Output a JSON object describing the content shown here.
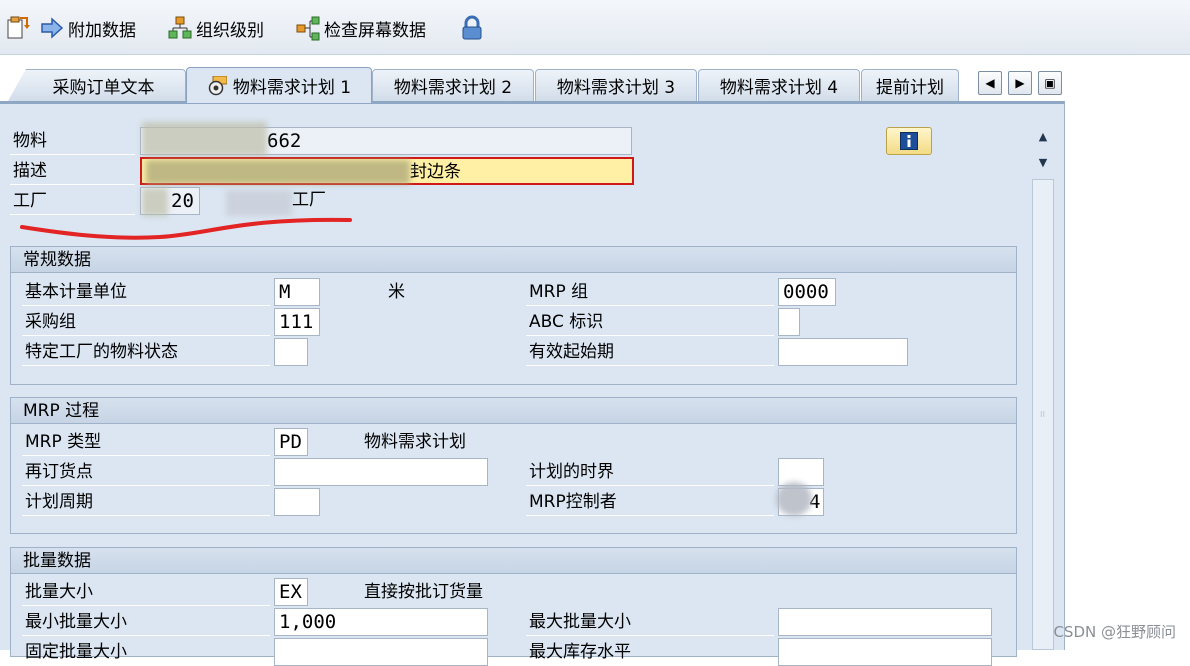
{
  "toolbar": {
    "additional_data": "附加数据",
    "org_levels": "组织级别",
    "check_screen_data": "检查屏幕数据"
  },
  "tabs": [
    {
      "label": "采购订单文本"
    },
    {
      "label": "物料需求计划 1"
    },
    {
      "label": "物料需求计划 2"
    },
    {
      "label": "物料需求计划 3"
    },
    {
      "label": "物料需求计划 4"
    },
    {
      "label": "提前计划"
    }
  ],
  "header": {
    "material_label": "物料",
    "material_value": "662",
    "description_label": "描述",
    "description_value": "封边条",
    "plant_label": "工厂",
    "plant_value": "20",
    "plant_name": "工厂"
  },
  "general": {
    "title": "常规数据",
    "base_unit_label": "基本计量单位",
    "base_unit_value": "M",
    "base_unit_text": "米",
    "mrp_group_label": "MRP 组",
    "mrp_group_value": "0000",
    "purch_group_label": "采购组",
    "purch_group_value": "111",
    "abc_label": "ABC 标识",
    "abc_value": "",
    "plant_status_label": "特定工厂的物料状态",
    "plant_status_value": "",
    "valid_from_label": "有效起始期",
    "valid_from_value": ""
  },
  "mrp": {
    "title": "MRP 过程",
    "type_label": "MRP 类型",
    "type_value": "PD",
    "type_text": "物料需求计划",
    "reorder_label": "再订货点",
    "reorder_value": "",
    "time_fence_label": "计划的时界",
    "time_fence_value": "",
    "cycle_label": "计划周期",
    "cycle_value": "",
    "controller_label": "MRP控制者",
    "controller_value": "4"
  },
  "lot": {
    "title": "批量数据",
    "size_label": "批量大小",
    "size_value": "EX",
    "size_text": "直接按批订货量",
    "min_label": "最小批量大小",
    "min_value": "1,000",
    "max_label": "最大批量大小",
    "max_value": "",
    "fixed_label": "固定批量大小",
    "maxstock_label": "最大库存水平"
  },
  "watermark": "CSDN @狂野顾问"
}
